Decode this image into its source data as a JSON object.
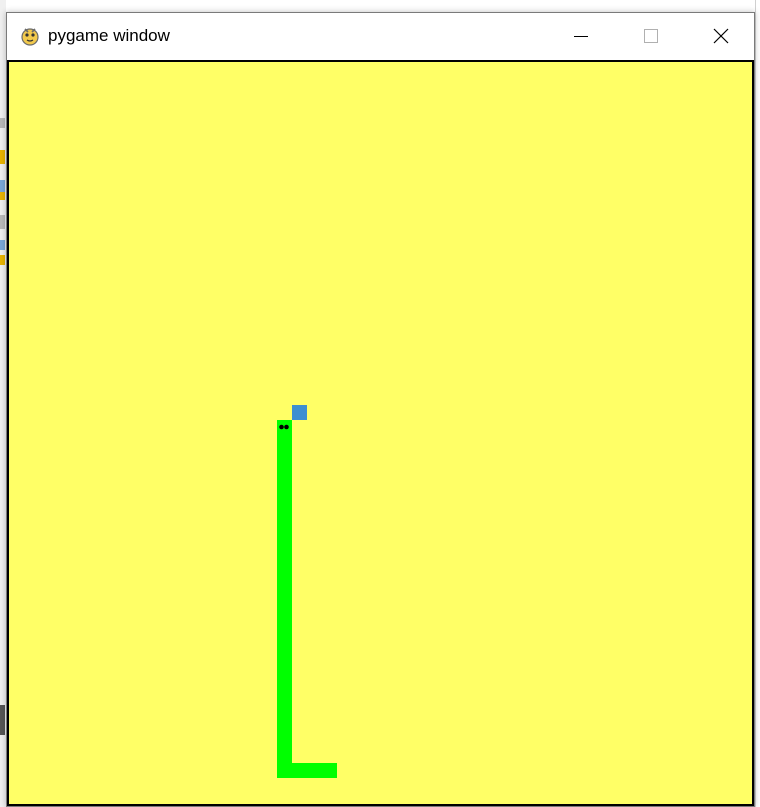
{
  "window": {
    "title": "pygame window",
    "controls": {
      "minimize": "minimize",
      "maximize": "maximize",
      "close": "close"
    }
  },
  "game": {
    "background_color": "#ffff66",
    "snake_color": "#00ff00",
    "snake_eye_color": "#000000",
    "food_color": "#3d8fd1",
    "grid_cell_units": "cells",
    "snake_length_cells": 27,
    "food_count": 1
  }
}
